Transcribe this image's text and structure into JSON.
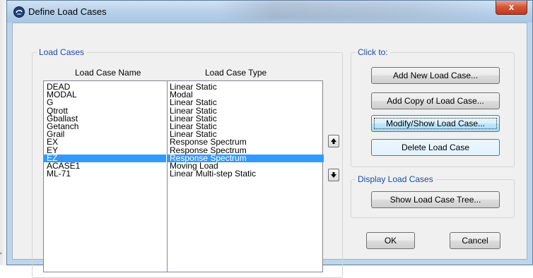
{
  "window": {
    "title": "Define Load Cases",
    "close_label": "x"
  },
  "load_cases": {
    "group_title": "Load Cases",
    "col_name_header": "Load Case Name",
    "col_type_header": "Load Case Type",
    "rows": [
      {
        "name": "DEAD",
        "type": "Linear Static"
      },
      {
        "name": "MODAL",
        "type": "Modal"
      },
      {
        "name": "G",
        "type": "Linear Static"
      },
      {
        "name": "Qtrott",
        "type": "Linear Static"
      },
      {
        "name": "Gballast",
        "type": "Linear Static"
      },
      {
        "name": "Getanch",
        "type": "Linear Static"
      },
      {
        "name": "Grail",
        "type": "Linear Static"
      },
      {
        "name": "EX",
        "type": "Response Spectrum"
      },
      {
        "name": "EY",
        "type": "Response Spectrum"
      },
      {
        "name": "EZ",
        "type": "Response Spectrum"
      },
      {
        "name": "ACASE1",
        "type": "Moving Load"
      },
      {
        "name": "ML-71",
        "type": "Linear Multi-step Static"
      }
    ],
    "selected_index": 9
  },
  "click_to": {
    "group_title": "Click to:",
    "add_new": "Add New Load Case...",
    "add_copy": "Add Copy of Load Case...",
    "modify_show": "Modify/Show Load Case...",
    "delete": "Delete Load Case"
  },
  "display": {
    "group_title": "Display Load Cases",
    "show_tree": "Show Load Case Tree..."
  },
  "footer": {
    "ok": "OK",
    "cancel": "Cancel"
  },
  "icons": {
    "app": "sap2000-logo-icon",
    "move_up": "arrow-up-icon",
    "move_down": "arrow-down-icon"
  },
  "colors": {
    "selection": "#3399ff",
    "group_title": "#1a4fa0",
    "close_button": "#c2371d"
  }
}
